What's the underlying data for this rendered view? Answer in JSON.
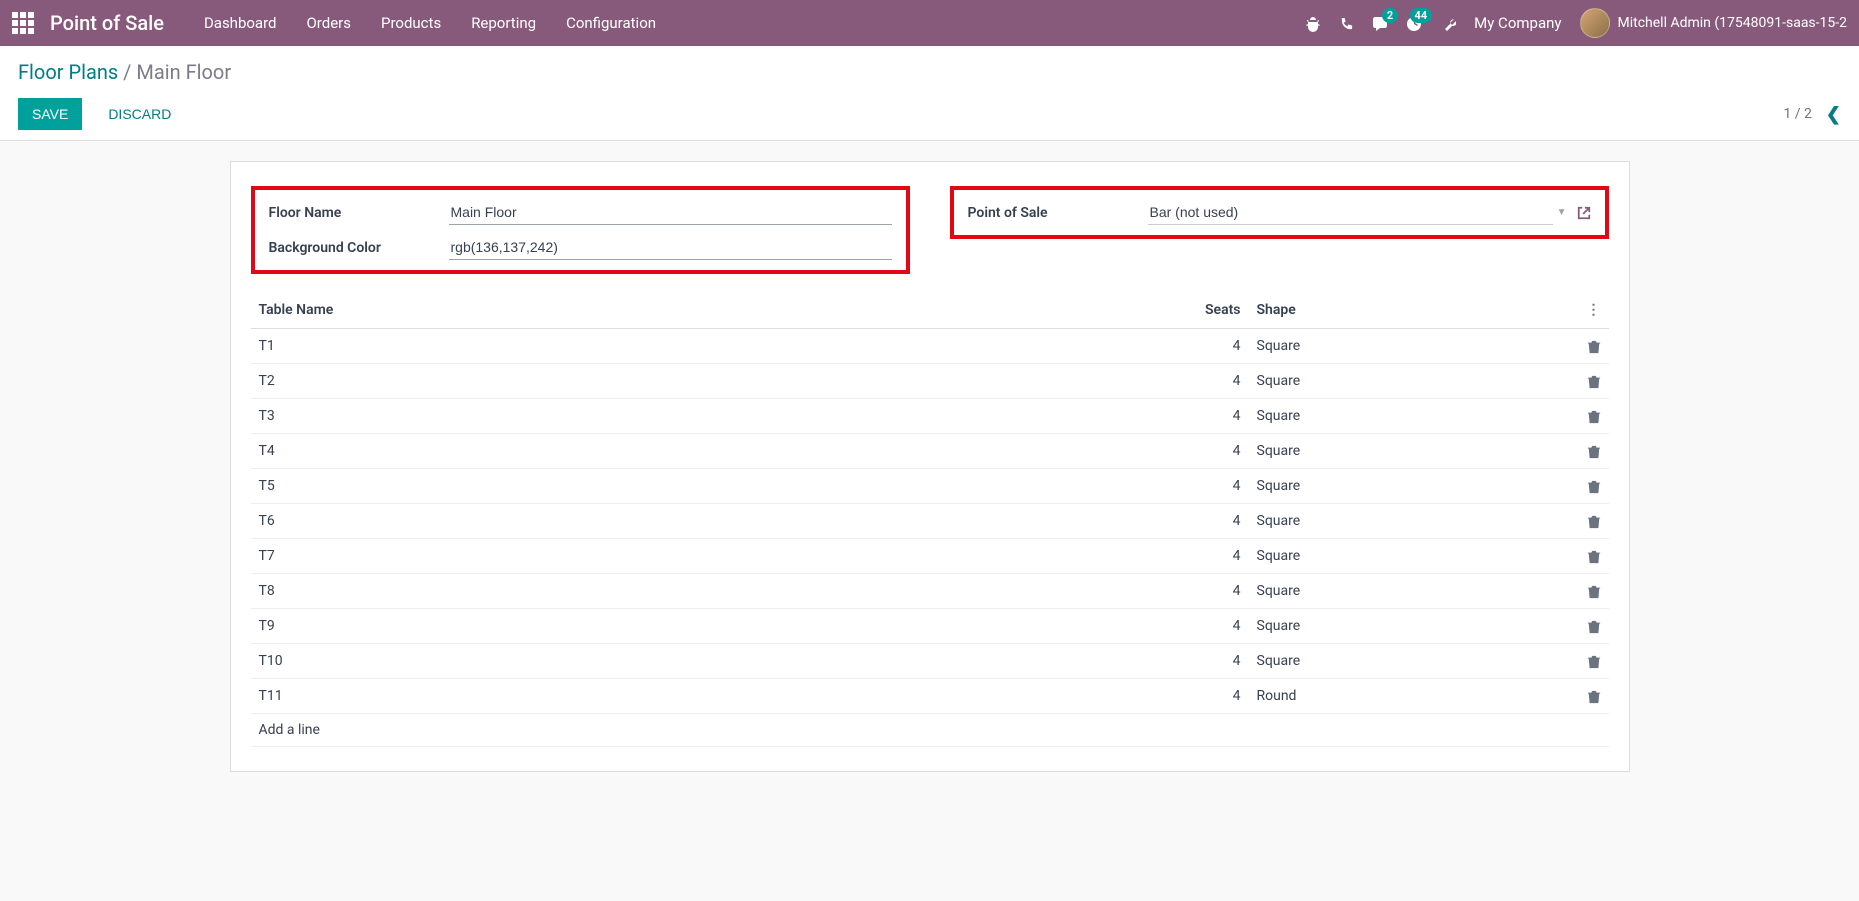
{
  "topbar": {
    "app_title": "Point of Sale",
    "nav": [
      "Dashboard",
      "Orders",
      "Products",
      "Reporting",
      "Configuration"
    ],
    "chat_badge": "2",
    "activity_badge": "44",
    "company": "My Company",
    "user": "Mitchell Admin (17548091-saas-15-2"
  },
  "breadcrumb": {
    "root": "Floor Plans",
    "current": "Main Floor"
  },
  "buttons": {
    "save": "SAVE",
    "discard": "DISCARD"
  },
  "pager": {
    "text": "1 / 2"
  },
  "form": {
    "floor_name_label": "Floor Name",
    "floor_name_value": "Main Floor",
    "bg_color_label": "Background Color",
    "bg_color_value": "rgb(136,137,242)",
    "pos_label": "Point of Sale",
    "pos_value": "Bar (not used)"
  },
  "table": {
    "headers": {
      "name": "Table Name",
      "seats": "Seats",
      "shape": "Shape"
    },
    "rows": [
      {
        "name": "T1",
        "seats": "4",
        "shape": "Square"
      },
      {
        "name": "T2",
        "seats": "4",
        "shape": "Square"
      },
      {
        "name": "T3",
        "seats": "4",
        "shape": "Square"
      },
      {
        "name": "T4",
        "seats": "4",
        "shape": "Square"
      },
      {
        "name": "T5",
        "seats": "4",
        "shape": "Square"
      },
      {
        "name": "T6",
        "seats": "4",
        "shape": "Square"
      },
      {
        "name": "T7",
        "seats": "4",
        "shape": "Square"
      },
      {
        "name": "T8",
        "seats": "4",
        "shape": "Square"
      },
      {
        "name": "T9",
        "seats": "4",
        "shape": "Square"
      },
      {
        "name": "T10",
        "seats": "4",
        "shape": "Square"
      },
      {
        "name": "T11",
        "seats": "4",
        "shape": "Round"
      }
    ],
    "add_line": "Add a line"
  }
}
